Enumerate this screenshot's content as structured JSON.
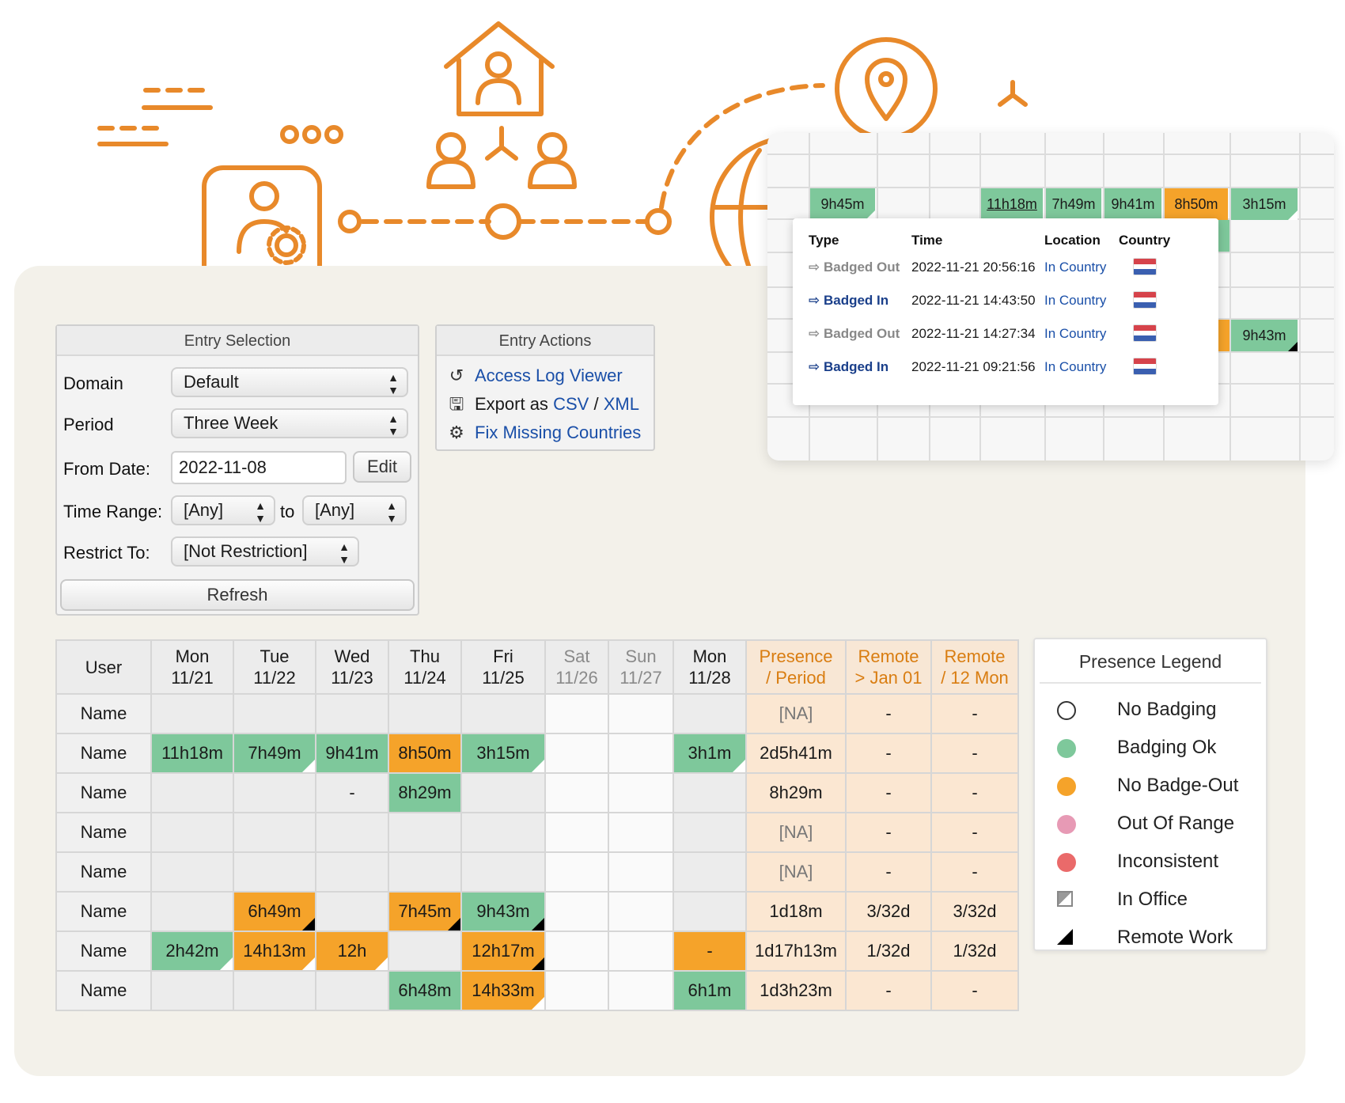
{
  "entry_selection": {
    "title": "Entry Selection",
    "domain_label": "Domain",
    "domain_value": "Default",
    "period_label": "Period",
    "period_value": "Three Week",
    "from_date_label": "From Date:",
    "from_date_value": "2022-11-08",
    "edit_label": "Edit",
    "time_range_label": "Time Range:",
    "time_from_value": "[Any]",
    "to_label": "to",
    "time_to_value": "[Any]",
    "restrict_label": "Restrict To:",
    "restrict_value": "[Not Restriction]",
    "refresh_label": "Refresh"
  },
  "entry_actions": {
    "title": "Entry Actions",
    "access_log": "Access Log Viewer",
    "export_prefix": "Export as",
    "export_csv": "CSV",
    "export_sep": "/",
    "export_xml": "XML",
    "fix_countries": "Fix Missing Countries"
  },
  "table": {
    "headers": [
      {
        "top": "User",
        "bottom": ""
      },
      {
        "top": "Mon",
        "bottom": "11/21"
      },
      {
        "top": "Tue",
        "bottom": "11/22"
      },
      {
        "top": "Wed",
        "bottom": "11/23"
      },
      {
        "top": "Thu",
        "bottom": "11/24"
      },
      {
        "top": "Fri",
        "bottom": "11/25"
      },
      {
        "top": "Sat",
        "bottom": "11/26"
      },
      {
        "top": "Sun",
        "bottom": "11/27"
      },
      {
        "top": "Mon",
        "bottom": "11/28"
      },
      {
        "top": "Presence",
        "bottom": "/ Period"
      },
      {
        "top": "Remote",
        "bottom": "> Jan 01"
      },
      {
        "top": "Remote",
        "bottom": "/ 12 Mon"
      }
    ],
    "rows": [
      {
        "name": "Name",
        "cells": [
          "",
          "",
          "",
          "",
          "",
          "",
          "",
          "",
          "[NA]",
          "-",
          "-"
        ]
      },
      {
        "name": "Name",
        "cells": [
          "11h18m",
          "7h49m",
          "9h41m",
          "8h50m",
          "3h15m",
          "",
          "",
          "3h1m",
          "2d5h41m",
          "-",
          "-"
        ]
      },
      {
        "name": "Name",
        "cells": [
          "",
          "",
          "-",
          "8h29m",
          "",
          "",
          "",
          "",
          "8h29m",
          "-",
          "-"
        ]
      },
      {
        "name": "Name",
        "cells": [
          "",
          "",
          "",
          "",
          "",
          "",
          "",
          "",
          "[NA]",
          "-",
          "-"
        ]
      },
      {
        "name": "Name",
        "cells": [
          "",
          "",
          "",
          "",
          "",
          "",
          "",
          "",
          "[NA]",
          "-",
          "-"
        ]
      },
      {
        "name": "Name",
        "cells": [
          "",
          "6h49m",
          "",
          "7h45m",
          "9h43m",
          "",
          "",
          "",
          "1d18m",
          "3/32d",
          "3/32d"
        ]
      },
      {
        "name": "Name",
        "cells": [
          "2h42m",
          "14h13m",
          "12h",
          "",
          "12h17m",
          "",
          "",
          "-",
          "1d17h13m",
          "1/32d",
          "1/32d"
        ]
      },
      {
        "name": "Name",
        "cells": [
          "",
          "",
          "",
          "6h48m",
          "14h33m",
          "",
          "",
          "6h1m",
          "1d3h23m",
          "-",
          "-"
        ]
      }
    ]
  },
  "legend": {
    "title": "Presence Legend",
    "items": [
      {
        "label": "No Badging",
        "color": "#ffffff"
      },
      {
        "label": "Badging Ok",
        "color": "#7ec89b"
      },
      {
        "label": "No Badge-Out",
        "color": "#f5a32a"
      },
      {
        "label": "Out Of Range",
        "color": "#e79ab5"
      },
      {
        "label": "Inconsistent",
        "color": "#ea6a6a"
      },
      {
        "label": "In Office",
        "icon": "in-office-corner-icon"
      },
      {
        "label": "Remote Work",
        "icon": "remote-work-corner-icon"
      }
    ]
  },
  "popup": {
    "strip": [
      "9h45m",
      "11h18m",
      "7h49m",
      "9h41m",
      "8h50m",
      "3h15m"
    ],
    "side_value": "9h43m",
    "headers": [
      "Type",
      "Time",
      "Location",
      "Country"
    ],
    "rows": [
      {
        "type": "Badged Out",
        "time": "2022-11-21 20:56:16",
        "location": "In Country"
      },
      {
        "type": "Badged In",
        "time": "2022-11-21 14:43:50",
        "location": "In Country"
      },
      {
        "type": "Badged Out",
        "time": "2022-11-21 14:27:34",
        "location": "In Country"
      },
      {
        "type": "Badged In",
        "time": "2022-11-21 09:21:56",
        "location": "In Country"
      }
    ]
  },
  "colors": {
    "accent": "#e8892a",
    "ok": "#7ec89b",
    "warn": "#f5a32a",
    "summary_bg": "#fbe7d2",
    "link": "#1a4fa8"
  }
}
